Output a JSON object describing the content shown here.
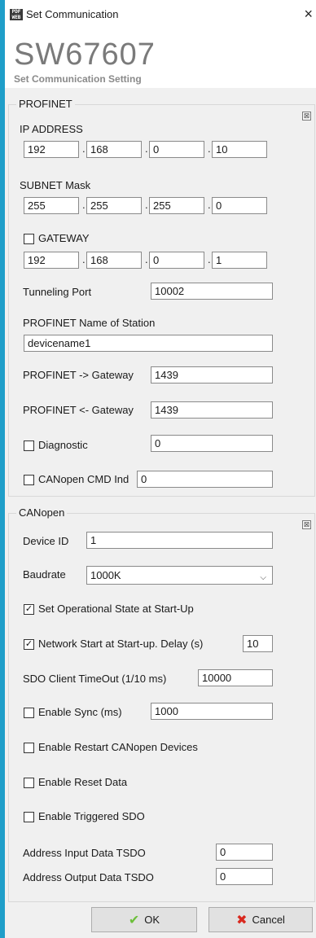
{
  "window": {
    "title": "Set Communication",
    "close_glyph": "×",
    "icon_text": "PDF WEB"
  },
  "header": {
    "product": "SW67607",
    "subtitle": "Set Communication Setting"
  },
  "profinet": {
    "legend": "PROFINET",
    "collapse_glyph": "⊠",
    "ip_label": "IP ADDRESS",
    "ip": [
      "192",
      "168",
      "0",
      "10"
    ],
    "subnet_label": "SUBNET Mask",
    "subnet": [
      "255",
      "255",
      "255",
      "0"
    ],
    "gateway_label": "GATEWAY",
    "gateway_checked": false,
    "gateway": [
      "192",
      "168",
      "0",
      "1"
    ],
    "tunneling_label": "Tunneling Port",
    "tunneling_value": "10002",
    "station_label": "PROFINET Name of Station",
    "station_value": "devicename1",
    "to_gateway_label": "PROFINET -> Gateway",
    "to_gateway_value": "1439",
    "from_gateway_label": "PROFINET <- Gateway",
    "from_gateway_value": "1439",
    "diagnostic_label": "Diagnostic",
    "diagnostic_value": "0",
    "canopen_cmd_label": "CANopen CMD Ind",
    "canopen_cmd_value": "0",
    "dot": "."
  },
  "canopen": {
    "legend": "CANopen",
    "collapse_glyph": "⊠",
    "device_id_label": "Device ID",
    "device_id_value": "1",
    "baudrate_label": "Baudrate",
    "baudrate_value": "1000K",
    "dropdown_glyph": "⌵",
    "set_operational_label": "Set Operational State at Start-Up",
    "set_operational_checked": true,
    "network_start_label": "Network Start at Start-up. Delay (s)",
    "network_start_checked": true,
    "network_start_value": "10",
    "sdo_timeout_label": "SDO Client TimeOut (1/10 ms)",
    "sdo_timeout_value": "10000",
    "enable_sync_label": "Enable Sync (ms)",
    "enable_sync_value": "1000",
    "enable_restart_label": "Enable Restart CANopen Devices",
    "enable_reset_label": "Enable Reset Data",
    "enable_triggered_label": "Enable Triggered SDO",
    "addr_input_label": "Address Input Data TSDO",
    "addr_input_value": "0",
    "addr_output_label": "Address Output Data TSDO",
    "addr_output_value": "0",
    "check_glyph": "✓"
  },
  "buttons": {
    "ok": "OK",
    "cancel": "Cancel",
    "ok_icon": "✔",
    "cancel_icon": "✖"
  },
  "colors": {
    "accent": "#1f9ec9",
    "ok_icon": "#6cbf3a",
    "cancel_icon": "#d9281e"
  }
}
